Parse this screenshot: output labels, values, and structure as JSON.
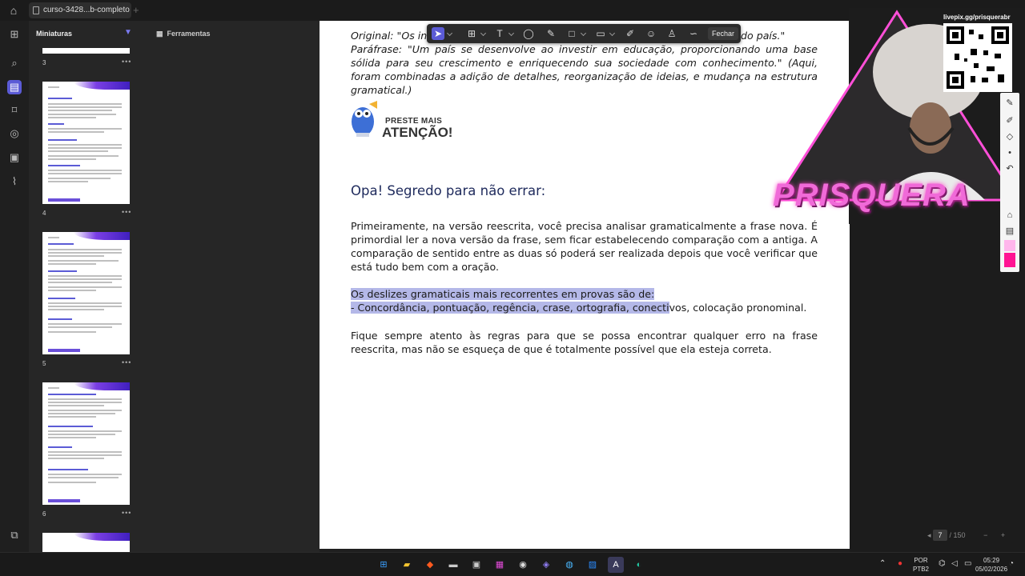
{
  "window": {
    "tab_title": "curso-3428...b-completo"
  },
  "sidebar": {
    "panel_title": "Miniaturas",
    "tools_title": "Ferramentas",
    "thumbnails": [
      {
        "page": "3"
      },
      {
        "page": "4"
      },
      {
        "page": "5"
      },
      {
        "page": "6"
      }
    ]
  },
  "annotation_toolbar": {
    "close_label": "Fechar",
    "tools": [
      "select-icon",
      "textbox-icon",
      "text-icon",
      "comment-icon",
      "highlight-icon",
      "shape-icon",
      "stamp-icon",
      "pencil-icon",
      "sticker-icon",
      "signature-icon",
      "strikethrough-icon"
    ]
  },
  "document": {
    "original_line": "Original: \"Os in",
    "original_line_end": "do país.\"",
    "parafrase": "Paráfrase: \"Um país se desenvolve ao investir em educação, proporcionando uma base sólida para seu crescimento e enriquecendo sua sociedade com conhecimento.\" (Aqui, foram combinadas a adição de detalhes, reorganização de ideias, e mudança na estrutura gramatical.)",
    "attention_small": "PRESTE MAIS",
    "attention_big": "ATENÇÃO!",
    "heading": "Opa! Segredo para não errar:",
    "paragraph1": "Primeiramente, na versão reescrita, você precisa analisar gramaticalmente a frase nova. É primordial ler a nova versão da frase, sem ficar estabelecendo comparação com a antiga. A comparação de sentido entre as duas só poderá ser realizada depois que você verificar que está tudo bem com a oração.",
    "highlight_line1": "Os deslizes gramaticais mais recorrentes em provas são de:",
    "highlight_line2": "- Concordância, pontuação, regência, crase, ortografia, conecti",
    "line2_rest": "vos, colocação pronominal.",
    "paragraph3": "Fique sempre atento às regras para que se possa encontrar qualquer erro na frase reescrita, mas não se esqueça de que é totalmente possível que ela esteja correta."
  },
  "pagination": {
    "current": "7",
    "total": "/ 150"
  },
  "overlay": {
    "qr_label": "livepix.gg/prisquerabr",
    "brand": "PRISQUERA"
  },
  "taskbar": {
    "lang_top": "POR",
    "lang_bottom": "PTB2",
    "time": "05:29",
    "date": "05/02/2026"
  }
}
